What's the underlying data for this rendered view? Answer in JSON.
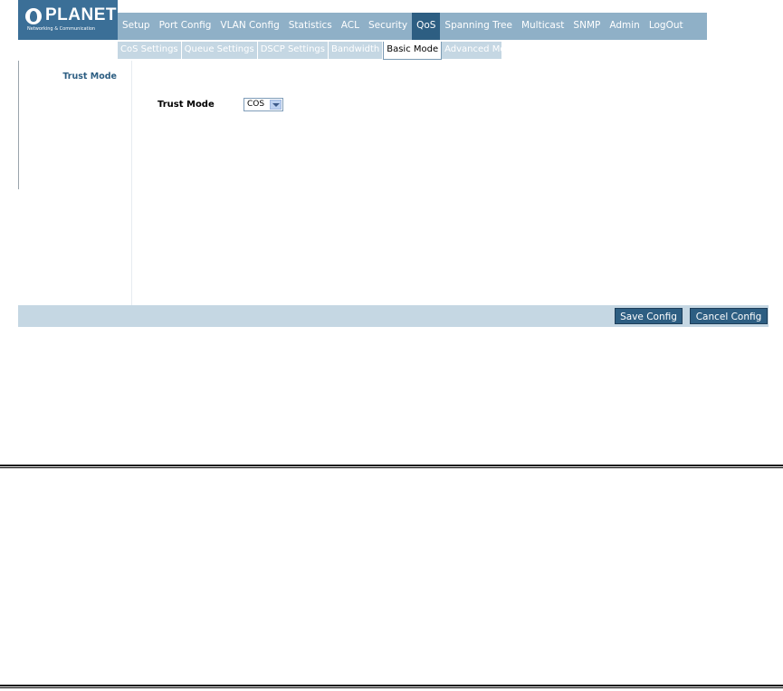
{
  "brand": {
    "name": "PLANET",
    "tagline": "Networking & Communication"
  },
  "main_nav": [
    {
      "label": "Setup",
      "active": false
    },
    {
      "label": "Port Config",
      "active": false
    },
    {
      "label": "VLAN Config",
      "active": false
    },
    {
      "label": "Statistics",
      "active": false
    },
    {
      "label": "ACL",
      "active": false
    },
    {
      "label": "Security",
      "active": false
    },
    {
      "label": "QoS",
      "active": true
    },
    {
      "label": "Spanning Tree",
      "active": false
    },
    {
      "label": "Multicast",
      "active": false
    },
    {
      "label": "SNMP",
      "active": false
    },
    {
      "label": "Admin",
      "active": false
    },
    {
      "label": "LogOut",
      "active": false
    }
  ],
  "sub_nav": [
    {
      "label": "CoS Settings",
      "active": false
    },
    {
      "label": "Queue Settings",
      "active": false
    },
    {
      "label": "DSCP Settings",
      "active": false
    },
    {
      "label": "Bandwidth",
      "active": false
    },
    {
      "label": "Basic Mode",
      "active": true
    },
    {
      "label": "Advanced Mode",
      "active": false
    }
  ],
  "sidebar": {
    "item": "Trust Mode"
  },
  "form": {
    "label": "Trust Mode",
    "value": "COS"
  },
  "footer": {
    "save": "Save Config",
    "cancel": "Cancel Config"
  },
  "colors": {
    "accent": "#2d5e82",
    "nav": "#8fb0c7",
    "subnav": "#c5d7e3"
  }
}
